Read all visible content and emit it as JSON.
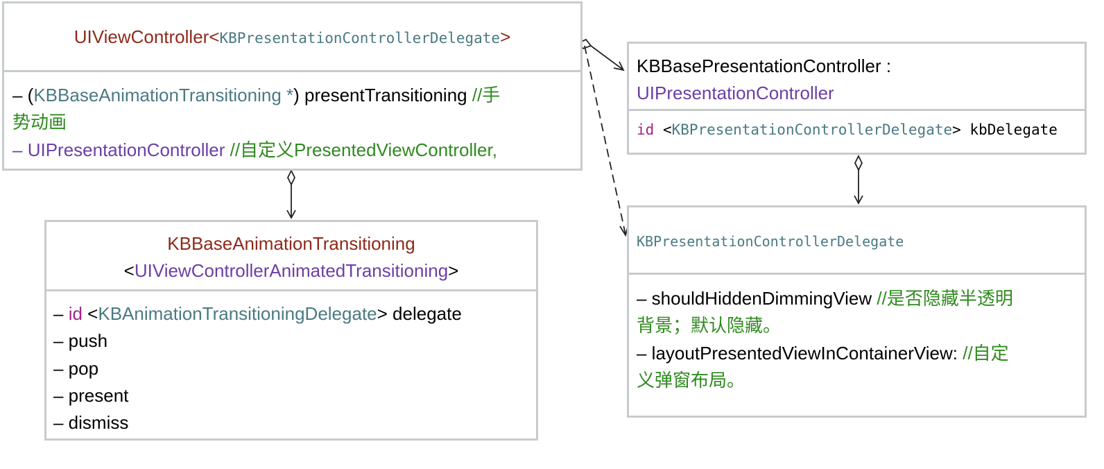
{
  "colors": {
    "class_name": "#8e2a1a",
    "protocol": "#4a7a82",
    "framework": "#6b3fa6",
    "comment": "#2f8a1f",
    "keyword": "#a3248a",
    "border": "#c8cbcd"
  },
  "uiviewcontroller": {
    "name": "UIViewController",
    "lt": "<",
    "protocol": "KBPresentationControllerDelegate",
    "gt": ">",
    "m1_dash": "– (",
    "m1_type": "KBBaseAnimationTransitioning",
    "m1_star": " *",
    "m1_rest": ") presentTransitioning ",
    "m1_comment_a": "//手",
    "m1_comment_b": "势动画",
    "m2_dash": "– ",
    "m2_type": "UIPresentationController",
    "m2_comment": " //自定义PresentedViewController,"
  },
  "transitioning": {
    "name": "KBBaseAnimationTransitioning",
    "lt": "<",
    "protocol": "UIViewControllerAnimatedTransitioning",
    "gt": ">",
    "m1_dash": "– ",
    "m1_kw": "id",
    "m1_lt": " <",
    "m1_protocol": "KBAnimationTransitioningDelegate",
    "m1_rest": "> delegate",
    "m2": "– push",
    "m3": "– pop",
    "m4": "– present",
    "m5": "– dismiss"
  },
  "presentation_controller": {
    "name": "KBBasePresentationController :",
    "superclass": "UIPresentationController",
    "p_kw": "id",
    "p_lt": " <",
    "p_protocol": "KBPresentationControllerDelegate",
    "p_rest": "> kbDelegate"
  },
  "delegate_protocol": {
    "name": "KBPresentationControllerDelegate",
    "m1": "– shouldHiddenDimmingView  ",
    "m1_comment_a": "//是否隐藏半透明",
    "m1_comment_b": "背景；默认隐藏。",
    "m2": "– layoutPresentedViewInContainerView:   ",
    "m2_comment_a": "//自定",
    "m2_comment_b": "义弹窗布局。"
  }
}
